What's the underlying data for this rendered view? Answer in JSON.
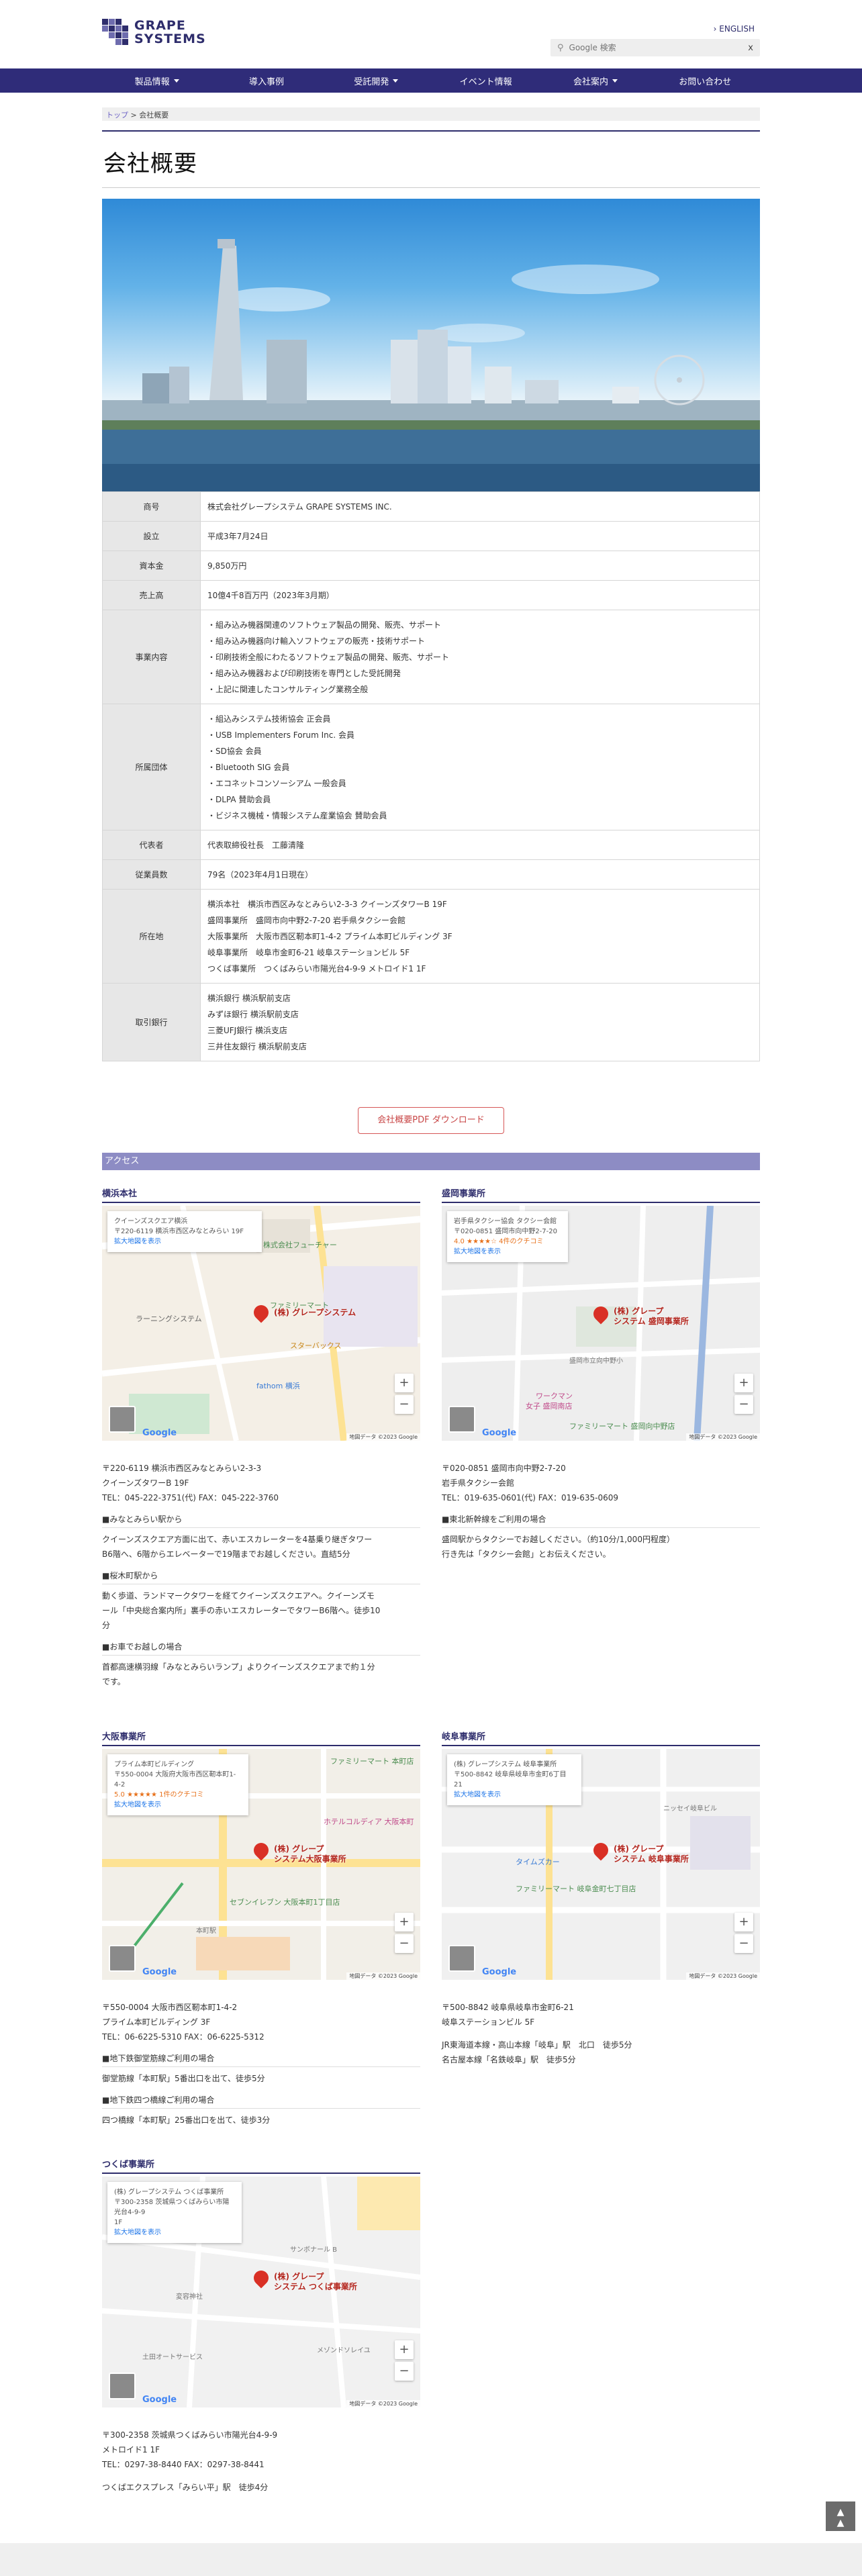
{
  "header": {
    "logo_line1": "GRAPE",
    "logo_line2": "SYSTEMS",
    "lang": "English",
    "search_placeholder": "Google 検索",
    "search_clear": "x"
  },
  "nav": [
    {
      "label": "製品情報",
      "dropdown": true
    },
    {
      "label": "導入事例",
      "dropdown": false
    },
    {
      "label": "受託開発",
      "dropdown": true
    },
    {
      "label": "イベント情報",
      "dropdown": false
    },
    {
      "label": "会社案内",
      "dropdown": true
    },
    {
      "label": "お問い合わせ",
      "dropdown": false
    }
  ],
  "breadcrumb": {
    "home": "トップ",
    "sep": " > ",
    "current": "会社概要"
  },
  "page_title": "会社概要",
  "company_table": [
    {
      "label": "商号",
      "lines": [
        "株式会社グレープシステム GRAPE SYSTEMS INC."
      ]
    },
    {
      "label": "設立",
      "lines": [
        "平成3年7月24日"
      ]
    },
    {
      "label": "資本金",
      "lines": [
        "9,850万円"
      ]
    },
    {
      "label": "売上高",
      "lines": [
        "10億4千8百万円（2023年3月期）"
      ]
    },
    {
      "label": "事業内容",
      "lines": [
        "・組み込み機器関連のソフトウェア製品の開発、販売、サポート",
        "・組み込み機器向け輸入ソフトウェアの販売・技術サポート",
        "・印刷技術全般にわたるソフトウェア製品の開発、販売、サポート",
        "・組み込み機器および印刷技術を専門とした受託開発",
        "・上記に関連したコンサルティング業務全般"
      ]
    },
    {
      "label": "所属団体",
      "lines": [
        "・組込みシステム技術協会 正会員",
        "・USB Implementers Forum Inc. 会員",
        "・SD協会 会員",
        "・Bluetooth SIG 会員",
        "・エコネットコンソーシアム 一般会員",
        "・DLPA 賛助会員",
        "・ビジネス機械・情報システム産業協会 賛助会員"
      ]
    },
    {
      "label": "代表者",
      "lines": [
        "代表取締役社長　工藤清隆"
      ]
    },
    {
      "label": "従業員数",
      "lines": [
        "79名（2023年4月1日現在）"
      ]
    },
    {
      "label": "所在地",
      "lines": [
        "横浜本社　横浜市西区みなとみらい2-3-3 クイーンズタワーB 19F",
        "盛岡事業所　盛岡市向中野2-7-20 岩手県タクシー会館",
        "大阪事業所　大阪市西区靭本町1-4-2 プライム本町ビルディング 3F",
        "岐阜事業所　岐阜市金町6-21 岐阜ステーションビル 5F",
        "つくば事業所　つくばみらい市陽光台4-9-9 メトロイド1 1F"
      ]
    },
    {
      "label": "取引銀行",
      "lines": [
        "横浜銀行 横浜駅前支店",
        "みずほ銀行 横浜駅前支店",
        "三菱UFJ銀行 横浜支店",
        "三井住友銀行 横浜駅前支店"
      ]
    }
  ],
  "pdf_button": "会社概要PDF ダウンロード",
  "access_title": "アクセス",
  "offices": [
    {
      "name": "横浜本社",
      "map_card": [
        "クイーンズスクエア横浜",
        "〒220-6119 横浜市西区みなとみらい 19F",
        "拡大地図を表示"
      ],
      "pin_label": [
        "(株) グレープシステム"
      ],
      "map_labels": [
        "株式会社フューチャー",
        "ファミリーマート",
        "スターバックス",
        "fathom 横浜",
        "ラーニングシステム"
      ],
      "address": [
        "〒220-6119 横浜市西区みなとみらい2-3-3",
        "クイーンズタワーB 19F",
        "TEL：045-222-3751(代) FAX：045-222-3760"
      ],
      "directions": [
        {
          "title": "■みなとみらい駅から",
          "text": [
            "クイーンズスクエア方面に出て、赤いエスカレーターを4基乗り継ぎタワー",
            "B6階へ、6階からエレベーターで19階までお越しください。直結5分"
          ]
        },
        {
          "title": "■桜木町駅から",
          "text": [
            "動く歩道、ランドマークタワーを経てクイーンズスクエアへ。クイーンズモ",
            "ール「中央総合案内所」裏手の赤いエスカレーターでタワーB6階へ。徒歩10",
            "分"
          ]
        },
        {
          "title": "■お車でお越しの場合",
          "text": [
            "首都高速横羽線「みなとみらいランプ」よりクイーンズスクエアまで約１分",
            "です。"
          ]
        }
      ]
    },
    {
      "name": "盛岡事業所",
      "map_card": [
        "岩手県タクシー協会 タクシー会館",
        "〒020-0851 盛岡市向中野2-7-20",
        "4.0 ★★★★☆  4件のクチコミ",
        "拡大地図を表示"
      ],
      "pin_label": [
        "(株) グレープ",
        "システム 盛岡事業所"
      ],
      "map_labels": [
        "盛岡市立向中野小",
        "ワークマン",
        "女子 盛岡南店",
        "ファミリーマート 盛岡向中野店"
      ],
      "address": [
        "〒020-0851 盛岡市向中野2-7-20",
        "岩手県タクシー会館",
        "TEL：019-635-0601(代) FAX：019-635-0609"
      ],
      "directions": [
        {
          "title": "■東北新幹線をご利用の場合",
          "text": [
            "盛岡駅からタクシーでお越しください。（約10分/1,000円程度）",
            "行き先は「タクシー会館」とお伝えください。"
          ]
        }
      ]
    },
    {
      "name": "大阪事業所",
      "map_card": [
        "プライム本町ビルディング",
        "〒550-0004 大阪府大阪市西区靭本町1-4-2",
        "5.0 ★★★★★  1件のクチコミ",
        "拡大地図を表示"
      ],
      "pin_label": [
        "(株) グレープ",
        "システム大阪事業所"
      ],
      "map_labels": [
        "ファミリーマート 本町店",
        "ホテルコルディア 大阪本町",
        "セブンイレブン 大阪本町1丁目店",
        "本町駅"
      ],
      "address": [
        "〒550-0004 大阪市西区靭本町1-4-2",
        "プライム本町ビルディング 3F",
        "TEL：06-6225-5310 FAX：06-6225-5312"
      ],
      "directions": [
        {
          "title": "■地下鉄御堂筋線ご利用の場合",
          "text": [
            "御堂筋線「本町駅」5番出口を出て、徒歩5分"
          ]
        },
        {
          "title": "■地下鉄四つ橋線ご利用の場合",
          "text": [
            "四つ橋線「本町駅」25番出口を出て、徒歩3分"
          ]
        }
      ]
    },
    {
      "name": "岐阜事業所",
      "map_card": [
        "(株) グレープシステム 岐阜事業所",
        "〒500-8842 岐阜県岐阜市金町6丁目21",
        "拡大地図を表示"
      ],
      "pin_label": [
        "(株) グレープ",
        "システム 岐阜事業所"
      ],
      "map_labels": [
        "ファミリーマート 岐阜金町七丁目店",
        "タイムズカー",
        "ニッセイ岐阜ビル"
      ],
      "address": [
        "〒500-8842 岐阜県岐阜市金町6-21",
        "岐阜ステーションビル 5F"
      ],
      "directions": [
        {
          "title": "",
          "text": [
            "JR東海道本線・高山本線「岐阜」駅　北口　徒歩5分",
            "名古屋本線「名鉄岐阜」駅　徒歩5分"
          ]
        }
      ]
    },
    {
      "name": "つくば事業所",
      "map_card": [
        "(株) グレープシステム つくば事業所",
        "〒300-2358 茨城県つくばみらい市陽光台4-9-9",
        "1F",
        "拡大地図を表示"
      ],
      "pin_label": [
        "(株) グレープ",
        "システム つくば事業所"
      ],
      "map_labels": [
        "サンボナール B",
        "変容神社",
        "土田オートサービス",
        "メゾンドソレイユ"
      ],
      "address": [
        "〒300-2358 茨城県つくばみらい市陽光台4-9-9",
        "メトロイド1 1F",
        "TEL：0297-38-8440 FAX：0297-38-8441"
      ],
      "directions": [
        {
          "title": "",
          "text": [
            "つくばエクスプレス「みらい平」駅　徒歩4分"
          ]
        }
      ]
    }
  ],
  "map_common": {
    "google": "Google",
    "copyright": "地図データ ©2023 Google",
    "zoom_in": "+",
    "zoom_out": "−"
  },
  "to_top": "▲"
}
